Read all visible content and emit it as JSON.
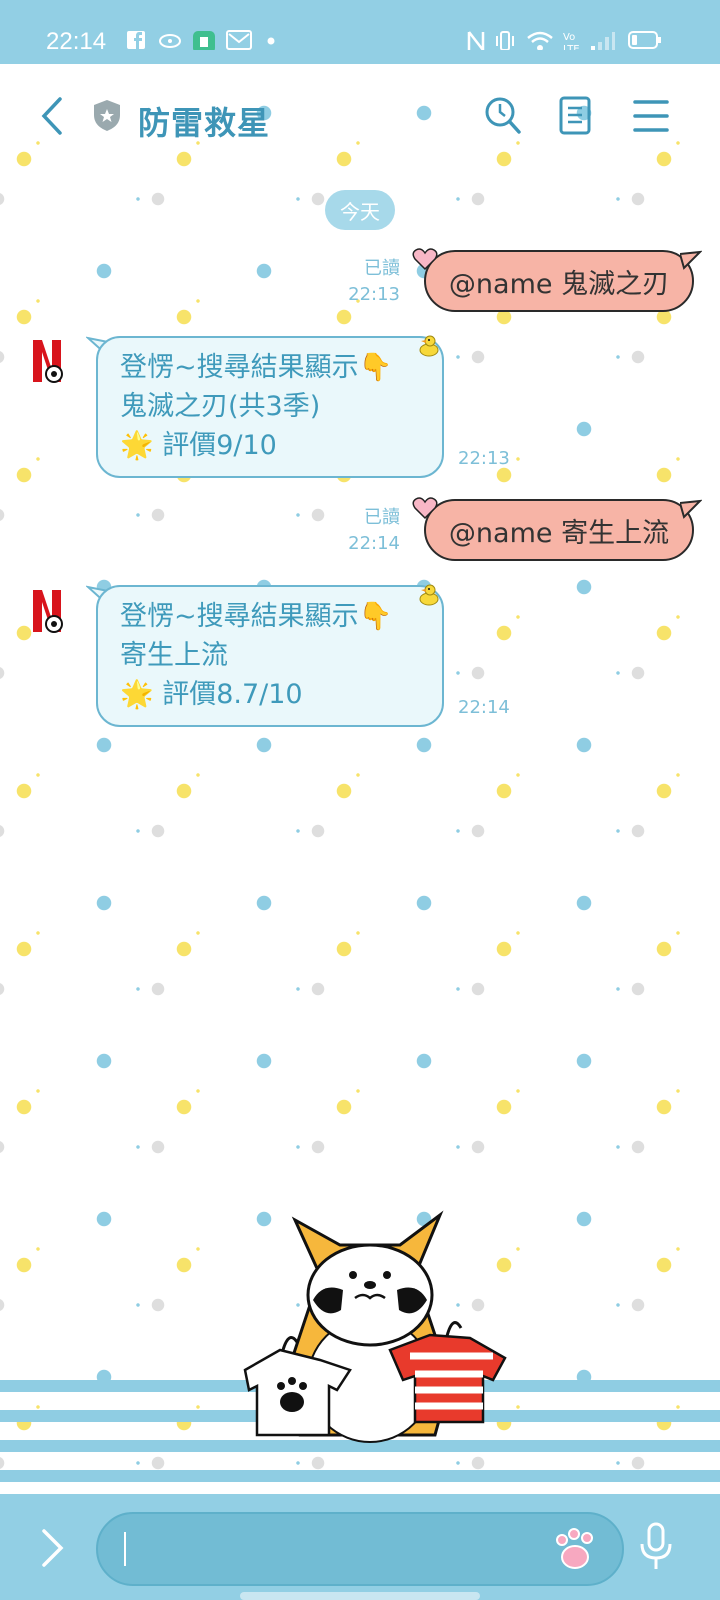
{
  "status_bar": {
    "time": "22:14"
  },
  "header": {
    "title": "防雷救星"
  },
  "chat": {
    "date_label": "今天",
    "messages": [
      {
        "direction": "out",
        "text": "@name 鬼滅之刃",
        "read_label": "已讀",
        "time": "22:13"
      },
      {
        "direction": "in",
        "lines": [
          "登愣~搜尋結果顯示👇",
          "鬼滅之刃(共3季)",
          "評價9/10"
        ],
        "time": "22:13"
      },
      {
        "direction": "out",
        "text": "@name 寄生上流",
        "read_label": "已讀",
        "time": "22:14"
      },
      {
        "direction": "in",
        "lines": [
          "登愣~搜尋結果顯示👇",
          "寄生上流",
          "評價8.7/10"
        ],
        "time": "22:14"
      }
    ]
  },
  "icons": {
    "status_bar": [
      "facebook-icon",
      "app-icon",
      "app-green-icon",
      "mail-icon",
      "dot-icon",
      "nfc-icon",
      "vibrate-icon",
      "wifi-icon",
      "volte-icon",
      "signal-icon",
      "battery-icon"
    ],
    "header": [
      "back-icon",
      "shield-icon",
      "search-icon",
      "notes-icon",
      "menu-icon"
    ],
    "input_bar": [
      "expand-icon",
      "paw-sticker-icon",
      "microphone-icon"
    ]
  },
  "colors": {
    "status_bar": "#92cfe4",
    "accent": "#3e95b7",
    "out_bubble": "#f7b4a6",
    "in_bubble": "#eaf8fb",
    "in_text": "#3f9abb"
  }
}
